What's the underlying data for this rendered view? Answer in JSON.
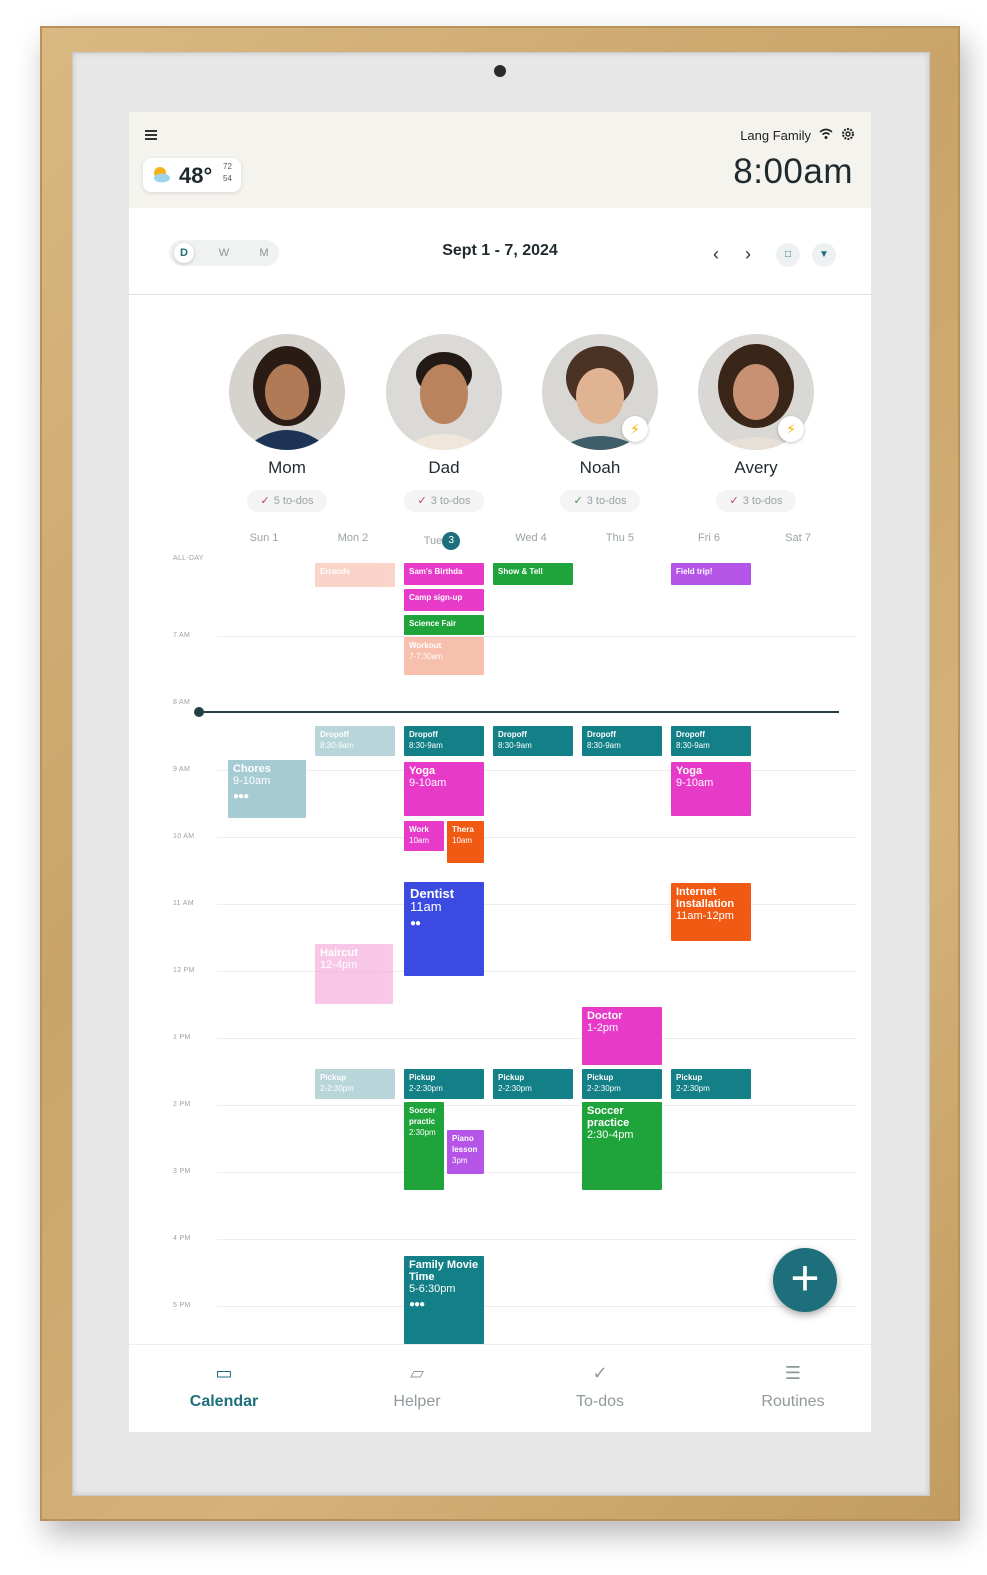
{
  "header": {
    "family_name": "Lang Family",
    "clock": "8:00am",
    "weather": {
      "temp": "48°",
      "high": "72",
      "low": "54",
      "icon": "partly-sunny-icon"
    }
  },
  "toolbar": {
    "views": [
      "D",
      "W",
      "M"
    ],
    "active_view": "D",
    "date_range": "Sept 1 - 7, 2024",
    "prev_label": "‹",
    "next_label": "›"
  },
  "profiles": [
    {
      "name": "Mom",
      "todos": "5 to-dos"
    },
    {
      "name": "Dad",
      "todos": "3 to-dos"
    },
    {
      "name": "Noah",
      "todos": "3 to-dos"
    },
    {
      "name": "Avery",
      "todos": "3 to-dos"
    }
  ],
  "calendar": {
    "days": [
      "Sun 1",
      "Mon 2",
      "Tue",
      "Wed 4",
      "Thu 5",
      "Fri 6",
      "Sat 7"
    ],
    "today_number": "3",
    "all_day_label": "ALL-DAY",
    "time_labels": [
      "7 AM",
      "8 AM",
      "9 AM",
      "10 AM",
      "11 AM",
      "12 PM",
      "1 PM",
      "2 PM",
      "3 PM",
      "4 PM",
      "5 PM"
    ],
    "events": {
      "errands": "Errands",
      "sams_birthday": "Sam's Birthda",
      "show_tell": "Show & Tell",
      "field_trip": "Field trip!",
      "camp_signup": "Camp sign-up",
      "science_fair": "Science Fair",
      "workout": "Workout",
      "workout_time": "7-7:30am",
      "dropoff": "Dropoff",
      "dropoff_time": "8:30-9am",
      "chores": "Chores",
      "chores_time": "9-10am",
      "yoga": "Yoga",
      "yoga_time": "9-10am",
      "work": "Work",
      "work_time": "10am",
      "thera": "Thera",
      "thera_time": "10am",
      "dentist": "Dentist",
      "dentist_time": "11am",
      "internet": "Internet Installation",
      "internet_time": "11am-12pm",
      "haircut": "Haircut",
      "haircut_time": "12-4pm",
      "doctor": "Doctor",
      "doctor_time": "1-2pm",
      "pickup": "Pickup",
      "pickup_time": "2-2:30pm",
      "soccer_short": "Soccer practic",
      "soccer_short_time": "2:30pm",
      "piano": "Piano lesson",
      "piano_time": "3pm",
      "soccer": "Soccer practice",
      "soccer_time": "2:30-4pm",
      "movie": "Family Movie Time",
      "movie_time": "5-6:30pm"
    },
    "colors": {
      "teal": "#137f87",
      "pink": "#e83ac9",
      "green": "#1ea43a",
      "orange": "#f05a12",
      "blue": "#3b4be2",
      "purple": "#b455e8",
      "salmon": "#f5b09c",
      "lightblue": "#a6cbd3",
      "lightpink": "#f7a9de"
    }
  },
  "bottom_nav": {
    "items": [
      "Calendar",
      "Helper",
      "To-dos",
      "Routines"
    ],
    "active": "Calendar"
  }
}
